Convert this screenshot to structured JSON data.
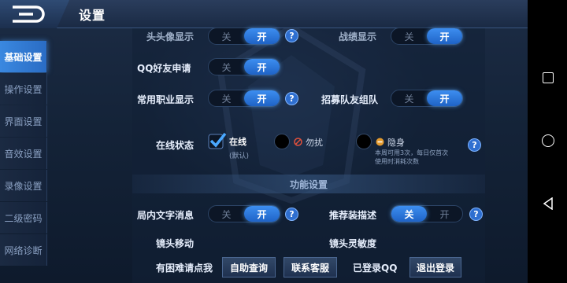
{
  "header": {
    "title": "设置"
  },
  "sidebar": {
    "items": [
      {
        "label": "基础设置",
        "active": true
      },
      {
        "label": "操作设置",
        "active": false
      },
      {
        "label": "界面设置",
        "active": false
      },
      {
        "label": "音效设置",
        "active": false
      },
      {
        "label": "录像设置",
        "active": false
      },
      {
        "label": "二级密码",
        "active": false
      },
      {
        "label": "网络诊断",
        "active": false
      }
    ]
  },
  "toggle_labels": {
    "off": "关",
    "on": "开"
  },
  "settings": {
    "avatar_frame": {
      "label": "头头像显示",
      "value": "on"
    },
    "battle_record": {
      "label": "战绩显示",
      "value": "on"
    },
    "qq_friend": {
      "label": "QQ好友申请",
      "value": "on"
    },
    "common_job": {
      "label": "常用职业显示",
      "value": "on"
    },
    "recruit_team": {
      "label": "招募队友组队",
      "value": "on"
    },
    "local_text": {
      "label": "局内文字消息",
      "value": "on"
    },
    "recommend_equip": {
      "label": "推荐装描述",
      "value": "off"
    }
  },
  "online_status": {
    "label": "在线状态",
    "options": [
      {
        "label": "在线",
        "sub": "(默认)",
        "selected": true
      },
      {
        "label": "勿扰",
        "selected": false
      },
      {
        "label": "隐身",
        "selected": false,
        "note": "本周可用3次，每日仅首次使用时消耗次数"
      }
    ]
  },
  "section": {
    "title": "功能设置"
  },
  "camera": {
    "move_label": "镜头移动",
    "sensitivity_label": "镜头灵敏度"
  },
  "footer": {
    "help_text": "有困难请点我",
    "self_query": "自助查询",
    "contact_service": "联系客服",
    "logged_in": "已登录QQ",
    "logout": "退出登录"
  },
  "help_glyph": "?",
  "colors": {
    "accent": "#3d8ef0",
    "active_tab": "#2a6cc4"
  }
}
